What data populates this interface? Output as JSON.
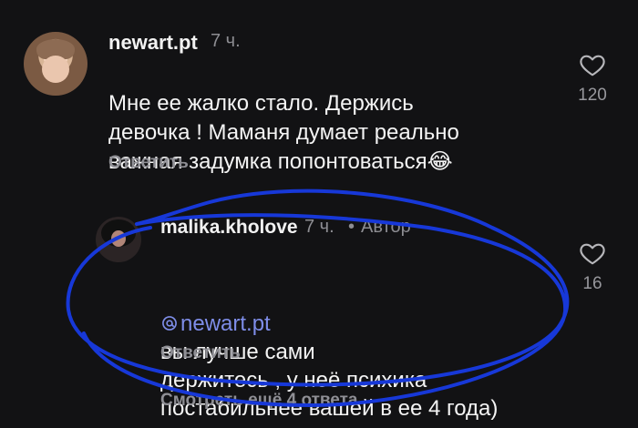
{
  "comments": [
    {
      "username": "newart.pt",
      "time": "7 ч.",
      "text": "Мне ее жалко стало. Держись\nдевочка ! Маманя думает реально\nважная задумка попонтоваться",
      "emoji": "😂",
      "reply_label": "Ответить",
      "likes": "120"
    },
    {
      "username": "malika.kholove",
      "time": "7 ч.",
      "separator": "•",
      "role": "Автор",
      "mention": "newart.pt",
      "text": " вы лучше сами\nдержитесь , у неё психика\nпостабильнее вашей в ее 4 года)",
      "reply_label": "Ответить",
      "likes": "16"
    }
  ],
  "thread": {
    "more_replies": "Смотреть ещё 4 ответа"
  },
  "colors": {
    "background": "#121214",
    "mention": "#7e8de8",
    "annotation": "#1738d8"
  },
  "icons": {
    "like": "heart-outline-icon",
    "mention": "at-sign-icon"
  }
}
